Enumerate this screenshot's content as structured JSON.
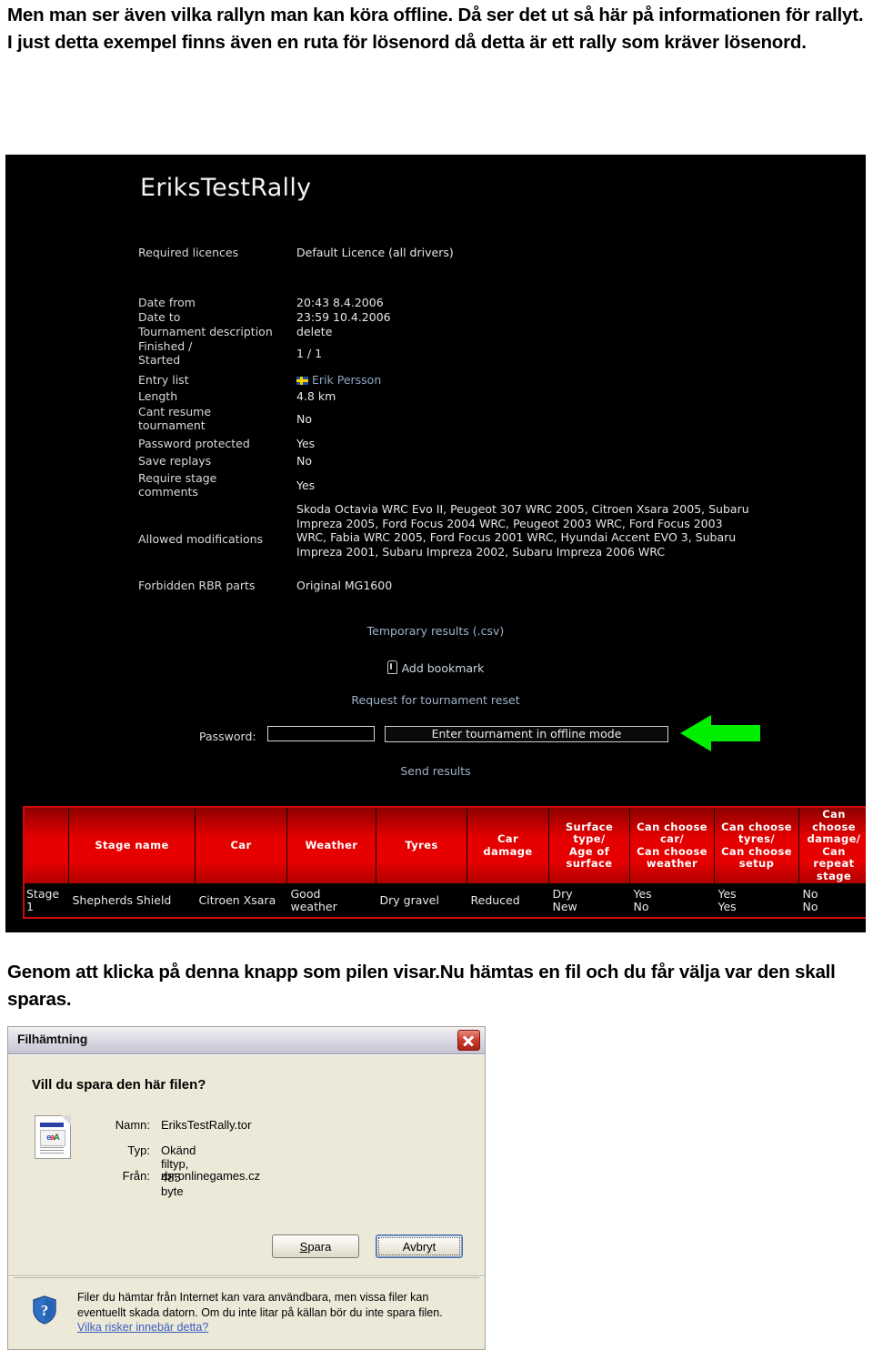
{
  "document": {
    "intro_text": "Men man ser även vilka rallyn man kan köra offline. Då ser det ut så här på informationen för rallyt.\nI just detta exempel finns även en ruta för lösenord då detta är ett rally som kräver lösenord.",
    "outro_text": "Genom att klicka på denna knapp som pilen visar.Nu hämtas en fil och du får välja var den skall sparas."
  },
  "rbr": {
    "title": "EriksTestRally",
    "details": [
      {
        "label": "Required licences",
        "value": "Default Licence (all drivers)"
      },
      {
        "label": "Date from",
        "value": "20:43 8.4.2006"
      },
      {
        "label": "Date to",
        "value": "23:59 10.4.2006"
      },
      {
        "label": "Tournament description",
        "value": "delete"
      },
      {
        "label": "Finished /\nStarted",
        "value": "1 / 1"
      },
      {
        "label": "Entry list",
        "value": "Erik Persson"
      },
      {
        "label": "Length",
        "value": "4.8 km"
      },
      {
        "label": "Cant resume\ntournament",
        "value": "No"
      },
      {
        "label": "Password protected",
        "value": "Yes"
      },
      {
        "label": "Save replays",
        "value": "No"
      },
      {
        "label": "Require stage\ncomments",
        "value": "Yes"
      },
      {
        "label": "Allowed modifications",
        "value": "Skoda Octavia WRC Evo II, Peugeot 307 WRC 2005, Citroen Xsara 2005, Subaru Impreza 2005, Ford Focus 2004 WRC, Peugeot 2003 WRC, Ford Focus 2003 WRC, Fabia WRC 2005, Ford Focus 2001 WRC, Hyundai Accent EVO 3, Subaru Impreza 2001, Subaru Impreza 2002, Subaru Impreza 2006 WRC"
      },
      {
        "label": "Forbidden RBR parts",
        "value": "Original MG1600"
      }
    ],
    "links": {
      "temporary_results": "Temporary results (.csv)",
      "add_bookmark": "Add bookmark",
      "tournament_reset": "Request for tournament reset",
      "send_results": "Send results"
    },
    "password": {
      "label": "Password:",
      "value": "",
      "placeholder": ""
    },
    "enter_offline_button": "Enter tournament in offline mode",
    "entry_flag": "swedish-flag-icon",
    "accent_green": "#00ee00",
    "accent_red": "#e30000"
  },
  "stage_table": {
    "headers": [
      "",
      "Stage name",
      "Car",
      "Weather",
      "Tyres",
      "Car\ndamage",
      "Surface\ntype/\nAge of\nsurface",
      "Can choose\ncar/\nCan choose\nweather",
      "Can choose\ntyres/\nCan choose\nsetup",
      "Can\nchoose\ndamage/\nCan\nrepeat\nstage"
    ],
    "rows": [
      [
        "Stage\n1",
        "Shepherds Shield",
        "Citroen Xsara",
        "Good\nweather",
        "Dry gravel",
        "Reduced",
        "Dry\nNew",
        "Yes\nNo",
        "Yes\nYes",
        "No\nNo"
      ]
    ]
  },
  "file_dialog": {
    "title": "Filhämtning",
    "question": "Vill du spara den här filen?",
    "meta": [
      {
        "key": "Namn:",
        "value": "EriksTestRally.tor"
      },
      {
        "key": "Typ:",
        "value": "Okänd filtyp, 485 byte"
      },
      {
        "key": "Från:",
        "value": "rbr.onlinegames.cz"
      }
    ],
    "buttons": {
      "save": "Spara",
      "save_accel": "S",
      "cancel": "Avbryt"
    },
    "warning_text": "Filer du hämtar från Internet kan vara användbara, men vissa filer kan eventuellt skada datorn. Om du inte litar på källan bör du inte spara filen.",
    "warning_link": "Vilka risker innebär detta?",
    "icons": {
      "close": "close-icon",
      "file": "file-type-icon",
      "shield": "shield-question-icon"
    }
  }
}
